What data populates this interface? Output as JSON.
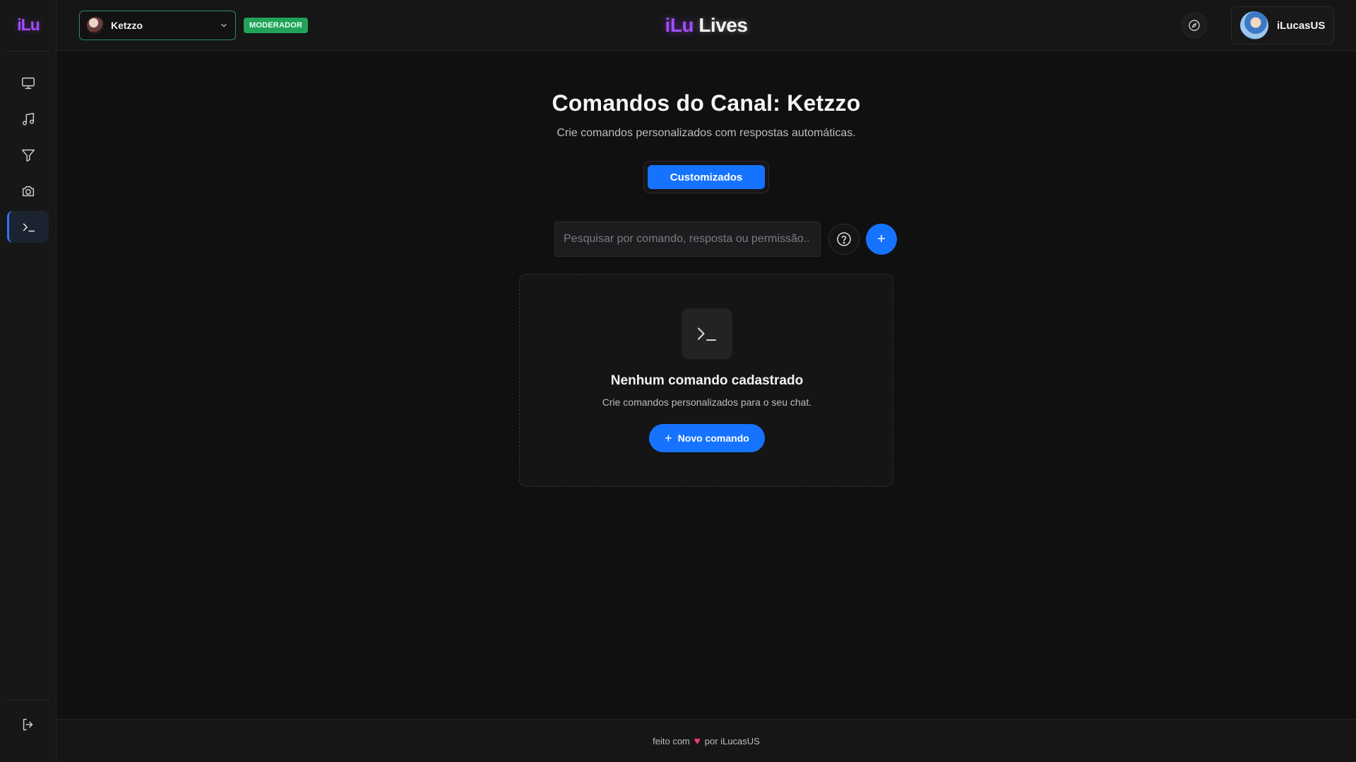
{
  "sidebar": {
    "logo": "iLu",
    "items": [
      {
        "name": "monitor-icon"
      },
      {
        "name": "music-icon"
      },
      {
        "name": "filter-icon"
      },
      {
        "name": "camera-icon"
      },
      {
        "name": "terminal-icon",
        "active": true
      }
    ],
    "logout_icon": "logout-icon"
  },
  "header": {
    "channel": "Ketzzo",
    "role_badge": "MODERADOR",
    "brand_part1": "iLu",
    "brand_part2": "Lives",
    "user_name": "iLucasUS"
  },
  "main": {
    "title": "Comandos do Canal: Ketzzo",
    "subtitle": "Crie comandos personalizados com respostas automáticas.",
    "tab_label": "Customizados",
    "search_placeholder": "Pesquisar por comando, resposta ou permissão..",
    "search_value": "",
    "add_label": "+",
    "empty_title": "Nenhum comando cadastrado",
    "empty_desc": "Crie comandos personalizados para o seu chat.",
    "new_button_plus": "+",
    "new_button_label": "Novo comando"
  },
  "footer": {
    "text_before": "feito com",
    "heart": "♥",
    "text_after": "por iLucasUS"
  },
  "colors": {
    "accent": "#1673ff",
    "brand_purple": "#a14cff",
    "badge_green": "#22a35a",
    "background": "#101011"
  }
}
